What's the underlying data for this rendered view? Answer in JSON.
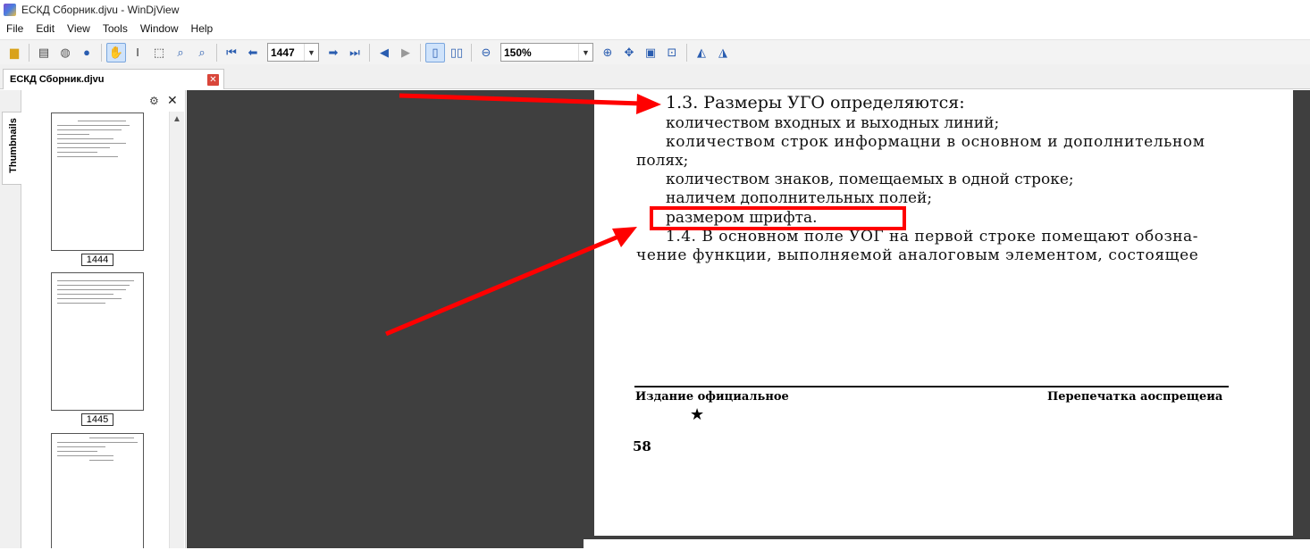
{
  "window": {
    "title": "ЕСКД Сборник.djvu - WinDjView"
  },
  "menu": {
    "items": [
      "File",
      "Edit",
      "View",
      "Tools",
      "Window",
      "Help"
    ]
  },
  "toolbar": {
    "page_value": "1447",
    "zoom_value": "150%"
  },
  "tabs": {
    "doc_tab_label": "ЕСКД Сборник.djvu",
    "side_tab_label": "Thumbnails"
  },
  "thumbnails": {
    "pages": [
      "1444",
      "1445"
    ]
  },
  "document": {
    "lines": [
      "1.3. Размеры УГО определяются:",
      "количеством входных и выходных линий;",
      "количеством строк информацни в основном и дополнительном",
      "полях;",
      "количеством знаков, помещаемых в одной строке;",
      "наличем дополнительных полей;",
      "размером шрифта.",
      "1.4. В основном поле УОГ на первой строке помещают обозна-",
      "чение функции, выполняемой аналоговым элементом, состоящее"
    ],
    "footer_left": "Издание официальное",
    "footer_right": "Перепечатка аоспрещеиа",
    "star": "★",
    "page_number": "58"
  },
  "colors": {
    "annotation": "#ff0000",
    "viewer_bg": "#3f3f3f",
    "toolbar_icon": "#2a5db0"
  }
}
